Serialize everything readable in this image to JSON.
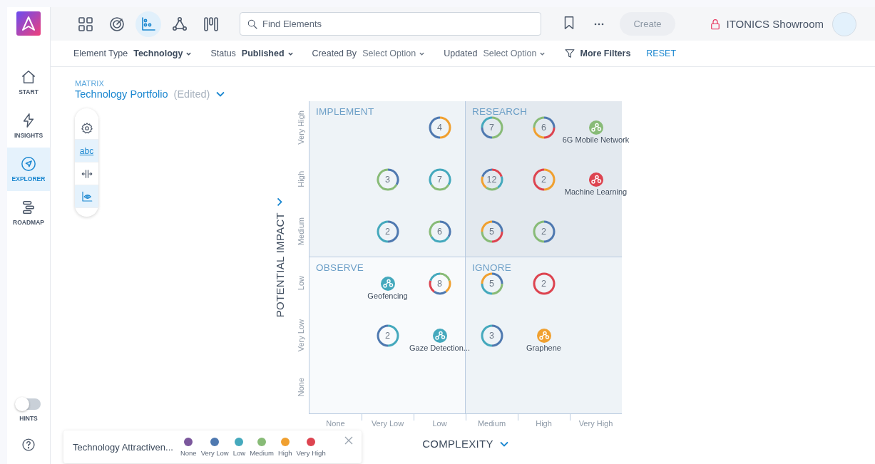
{
  "sidebar": {
    "items": [
      {
        "label": "START",
        "kind": "home",
        "selected": false
      },
      {
        "label": "INSIGHTS",
        "kind": "bolt",
        "selected": false
      },
      {
        "label": "EXPLORER",
        "kind": "compass",
        "selected": true
      },
      {
        "label": "ROADMAP",
        "kind": "roadmap",
        "selected": false
      }
    ],
    "hints": {
      "label": "HINTS",
      "on": false
    }
  },
  "header": {
    "views": [
      {
        "kind": "grid",
        "selected": false
      },
      {
        "kind": "radar",
        "selected": false
      },
      {
        "kind": "matrix",
        "selected": true
      },
      {
        "kind": "network",
        "selected": false
      },
      {
        "kind": "kanban",
        "selected": false
      }
    ],
    "search": {
      "placeholder": "Find Elements"
    },
    "create_button": {
      "label": "Create",
      "disabled": true
    },
    "workspace": "ITONICS Showroom"
  },
  "filters": [
    {
      "label": "Element Type",
      "value": "Technology"
    },
    {
      "label": "Status",
      "value": "Published"
    },
    {
      "label": "Created By",
      "placeholder": "Select Option"
    },
    {
      "label": "Updated",
      "placeholder": "Select Option"
    }
  ],
  "more_filters": "More Filters",
  "reset": "RESET",
  "matrix": {
    "caption": "MATRIX",
    "title": "Technology Portfolio",
    "status": "(Edited)",
    "tools": [
      {
        "kind": "settings",
        "selected": false
      },
      {
        "kind": "labels",
        "label": "abc",
        "selected": true
      },
      {
        "kind": "spacing",
        "selected": false
      },
      {
        "kind": "visibility",
        "selected": true
      }
    ],
    "y_axis": {
      "title": "POTENTIAL IMPACT",
      "ticks": [
        "Very High",
        "High",
        "Medium",
        "Low",
        "Very Low",
        "None"
      ]
    },
    "x_axis": {
      "title": "COMPLEXITY",
      "ticks": [
        "None",
        "Very Low",
        "Low",
        "Medium",
        "High",
        "Very High"
      ]
    },
    "quadrants": [
      {
        "label": "IMPLEMENT"
      },
      {
        "label": "RESEARCH"
      },
      {
        "label": "OBSERVE"
      },
      {
        "label": "IGNORE"
      }
    ],
    "rows": [
      {
        "cells": [
          {
            "kind": "empty"
          },
          {
            "kind": "empty"
          },
          {
            "kind": "cluster",
            "count": "4",
            "ring": [
              {
                "color": "#f0a030"
              },
              {
                "color": "#4f79b0"
              }
            ]
          },
          {
            "kind": "cluster",
            "count": "7",
            "ring": [
              {
                "color": "#88bb77"
              },
              {
                "color": "#88bb77"
              },
              {
                "color": "#4f79b0"
              },
              {
                "color": "#45a9bd"
              }
            ]
          },
          {
            "kind": "cluster",
            "count": "6",
            "ring": [
              {
                "color": "#4f79b0"
              },
              {
                "color": "#dd4450"
              },
              {
                "color": "#f0a030"
              },
              {
                "color": "#88bb77"
              }
            ]
          },
          {
            "kind": "element",
            "label": "6G Mobile Network",
            "color": "#88bb77"
          }
        ]
      },
      {
        "cells": [
          {
            "kind": "empty"
          },
          {
            "kind": "cluster",
            "count": "3",
            "ring": [
              {
                "color": "#4f79b0"
              },
              {
                "color": "#88bb77"
              },
              {
                "color": "#88bb77"
              }
            ]
          },
          {
            "kind": "cluster",
            "count": "7",
            "ring": [
              {
                "color": "#45a9bd"
              },
              {
                "color": "#88bb77"
              },
              {
                "color": "#45a9bd"
              }
            ]
          },
          {
            "kind": "cluster",
            "count": "12",
            "ring": [
              {
                "color": "#dd4450"
              },
              {
                "color": "#45a9bd"
              },
              {
                "color": "#88bb77"
              },
              {
                "color": "#f0a030"
              },
              {
                "color": "#4f79b0"
              }
            ]
          },
          {
            "kind": "cluster",
            "count": "2",
            "ring": [
              {
                "color": "#f0a030"
              },
              {
                "color": "#dd4450"
              }
            ]
          },
          {
            "kind": "element",
            "label": "Machine Learning",
            "color": "#dd4450"
          }
        ]
      },
      {
        "cells": [
          {
            "kind": "empty"
          },
          {
            "kind": "cluster",
            "count": "2",
            "ring": [
              {
                "color": "#4f79b0"
              },
              {
                "color": "#45a9bd"
              }
            ]
          },
          {
            "kind": "cluster",
            "count": "6",
            "ring": [
              {
                "color": "#4f79b0"
              },
              {
                "color": "#45a9bd"
              },
              {
                "color": "#88bb77"
              }
            ]
          },
          {
            "kind": "cluster",
            "count": "5",
            "ring": [
              {
                "color": "#4f79b0"
              },
              {
                "color": "#dd4450"
              },
              {
                "color": "#88bb77"
              },
              {
                "color": "#f0a030"
              }
            ]
          },
          {
            "kind": "cluster",
            "count": "2",
            "ring": [
              {
                "color": "#4f79b0"
              },
              {
                "color": "#88bb77"
              }
            ]
          },
          {
            "kind": "empty"
          }
        ]
      },
      {
        "cells": [
          {
            "kind": "empty"
          },
          {
            "kind": "element",
            "label": "Geofencing",
            "color": "#45a9bd"
          },
          {
            "kind": "cluster",
            "count": "8",
            "ring": [
              {
                "color": "#88bb77"
              },
              {
                "color": "#f0a030"
              },
              {
                "color": "#4f79b0"
              },
              {
                "color": "#dd4450"
              },
              {
                "color": "#45a9bd"
              }
            ]
          },
          {
            "kind": "cluster",
            "count": "5",
            "ring": [
              {
                "color": "#4f79b0"
              },
              {
                "color": "#88bb77"
              },
              {
                "color": "#45a9bd"
              },
              {
                "color": "#f0a030"
              }
            ]
          },
          {
            "kind": "cluster",
            "count": "2",
            "ring": [
              {
                "color": "#dd4450"
              }
            ]
          },
          {
            "kind": "empty"
          }
        ]
      },
      {
        "cells": [
          {
            "kind": "empty"
          },
          {
            "kind": "cluster",
            "count": "2",
            "ring": [
              {
                "color": "#45a9bd"
              },
              {
                "color": "#4f79b0"
              }
            ]
          },
          {
            "kind": "element",
            "label": "Gaze Detection...",
            "color": "#45a9bd"
          },
          {
            "kind": "cluster",
            "count": "3",
            "ring": [
              {
                "color": "#4f79b0"
              },
              {
                "color": "#45a9bd"
              }
            ]
          },
          {
            "kind": "element",
            "label": "Graphene",
            "color": "#f0a030"
          },
          {
            "kind": "empty"
          }
        ]
      },
      {
        "cells": [
          {
            "kind": "empty"
          },
          {
            "kind": "empty"
          },
          {
            "kind": "empty"
          },
          {
            "kind": "empty"
          },
          {
            "kind": "empty"
          },
          {
            "kind": "empty"
          }
        ]
      }
    ]
  },
  "legend": {
    "title": "Technology Attractiven...",
    "items": [
      {
        "label": "None",
        "color": "#7b579c"
      },
      {
        "label": "Very Low",
        "color": "#4f79b0"
      },
      {
        "label": "Low",
        "color": "#45a9bd"
      },
      {
        "label": "Medium",
        "color": "#88bb77"
      },
      {
        "label": "High",
        "color": "#f0a030"
      },
      {
        "label": "Very High",
        "color": "#dd4450"
      }
    ]
  }
}
